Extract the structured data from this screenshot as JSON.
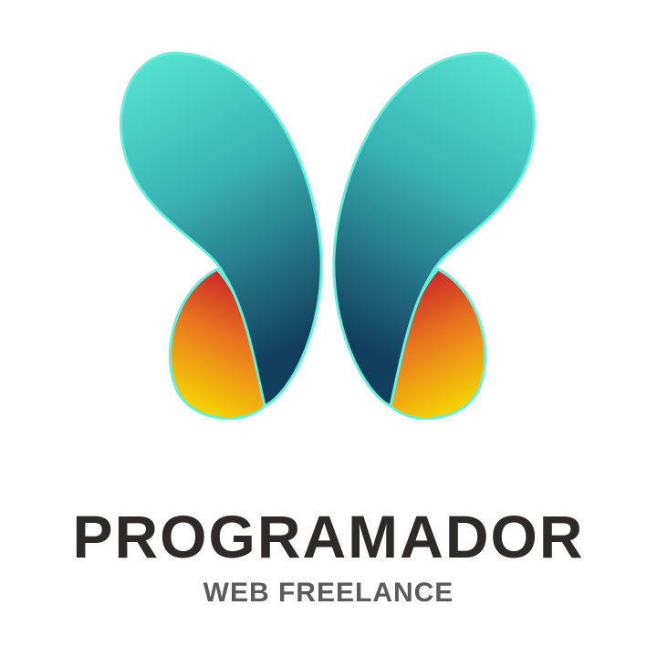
{
  "brand": {
    "title": "PROGRAMADOR",
    "subtitle": "WEB FREELANCE",
    "colors": {
      "wing_top": "#5ae8d4",
      "wing_bottom": "#134a66",
      "drop_top": "#d2302a",
      "drop_bottom": "#f5d800",
      "title": "#2f2a2a",
      "subtitle": "#5b5b5b"
    }
  }
}
